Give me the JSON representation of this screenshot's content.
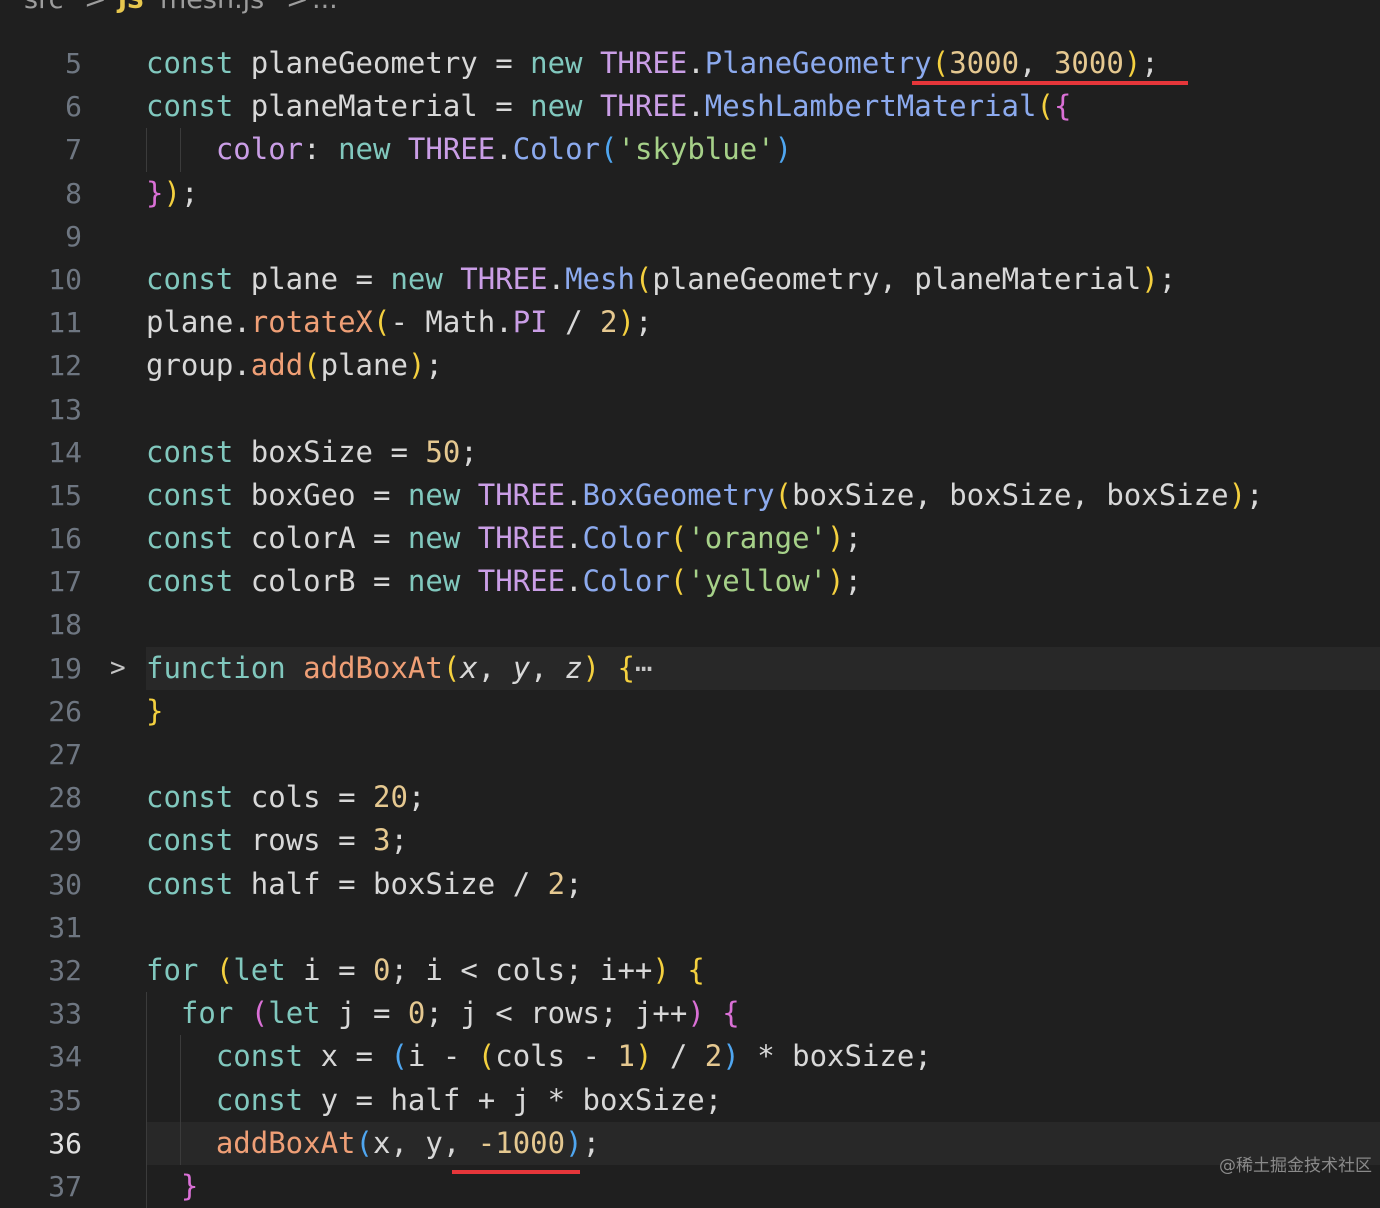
{
  "breadcrumb": {
    "folder": "src",
    "separator": ">",
    "file_icon": "JS",
    "file": "mesh.js",
    "tail": "..."
  },
  "editor": {
    "active_line": "36",
    "colors": {
      "keyword": "#81c8be",
      "class": "#ca9ee6",
      "method": "#8caaee",
      "function": "#ef9f76",
      "number": "#e5c890",
      "string": "#a6d189",
      "annotation_underline": "#e5363a"
    },
    "lines": [
      {
        "n": "5",
        "tokens": [
          [
            "kw",
            "const "
          ],
          [
            "id",
            "planeGeometry "
          ],
          [
            "op",
            "= "
          ],
          [
            "kw",
            "new "
          ],
          [
            "cls",
            "THREE"
          ],
          [
            "op",
            "."
          ],
          [
            "meth",
            "PlaneGeometry"
          ],
          [
            "p1",
            "("
          ],
          [
            "num",
            "3000"
          ],
          [
            "op",
            ", "
          ],
          [
            "num",
            "3000"
          ],
          [
            "p1",
            ")"
          ],
          [
            "op",
            ";"
          ]
        ]
      },
      {
        "n": "6",
        "tokens": [
          [
            "kw",
            "const "
          ],
          [
            "id",
            "planeMaterial "
          ],
          [
            "op",
            "= "
          ],
          [
            "kw",
            "new "
          ],
          [
            "cls",
            "THREE"
          ],
          [
            "op",
            "."
          ],
          [
            "meth",
            "MeshLambertMaterial"
          ],
          [
            "p1",
            "("
          ],
          [
            "p2",
            "{"
          ]
        ]
      },
      {
        "n": "7",
        "tokens": [
          [
            "id",
            "    "
          ],
          [
            "prop",
            "color"
          ],
          [
            "op",
            ": "
          ],
          [
            "kw",
            "new "
          ],
          [
            "cls",
            "THREE"
          ],
          [
            "op",
            "."
          ],
          [
            "meth",
            "Color"
          ],
          [
            "p3",
            "("
          ],
          [
            "str",
            "'skyblue'"
          ],
          [
            "p3",
            ")"
          ]
        ]
      },
      {
        "n": "8",
        "tokens": [
          [
            "p2",
            "}"
          ],
          [
            "p1",
            ")"
          ],
          [
            "op",
            ";"
          ]
        ]
      },
      {
        "n": "9",
        "tokens": []
      },
      {
        "n": "10",
        "tokens": [
          [
            "kw",
            "const "
          ],
          [
            "id",
            "plane "
          ],
          [
            "op",
            "= "
          ],
          [
            "kw",
            "new "
          ],
          [
            "cls",
            "THREE"
          ],
          [
            "op",
            "."
          ],
          [
            "meth",
            "Mesh"
          ],
          [
            "p1",
            "("
          ],
          [
            "id",
            "planeGeometry"
          ],
          [
            "op",
            ", "
          ],
          [
            "id",
            "planeMaterial"
          ],
          [
            "p1",
            ")"
          ],
          [
            "op",
            ";"
          ]
        ]
      },
      {
        "n": "11",
        "tokens": [
          [
            "id",
            "plane"
          ],
          [
            "op",
            "."
          ],
          [
            "fn",
            "rotateX"
          ],
          [
            "p1",
            "("
          ],
          [
            "op",
            "- "
          ],
          [
            "id",
            "Math"
          ],
          [
            "op",
            "."
          ],
          [
            "cls",
            "PI "
          ],
          [
            "op",
            "/ "
          ],
          [
            "num",
            "2"
          ],
          [
            "p1",
            ")"
          ],
          [
            "op",
            ";"
          ]
        ]
      },
      {
        "n": "12",
        "tokens": [
          [
            "id",
            "group"
          ],
          [
            "op",
            "."
          ],
          [
            "fn",
            "add"
          ],
          [
            "p1",
            "("
          ],
          [
            "id",
            "plane"
          ],
          [
            "p1",
            ")"
          ],
          [
            "op",
            ";"
          ]
        ]
      },
      {
        "n": "13",
        "tokens": []
      },
      {
        "n": "14",
        "tokens": [
          [
            "kw",
            "const "
          ],
          [
            "id",
            "boxSize "
          ],
          [
            "op",
            "= "
          ],
          [
            "num",
            "50"
          ],
          [
            "op",
            ";"
          ]
        ]
      },
      {
        "n": "15",
        "tokens": [
          [
            "kw",
            "const "
          ],
          [
            "id",
            "boxGeo "
          ],
          [
            "op",
            "= "
          ],
          [
            "kw",
            "new "
          ],
          [
            "cls",
            "THREE"
          ],
          [
            "op",
            "."
          ],
          [
            "meth",
            "BoxGeometry"
          ],
          [
            "p1",
            "("
          ],
          [
            "id",
            "boxSize"
          ],
          [
            "op",
            ", "
          ],
          [
            "id",
            "boxSize"
          ],
          [
            "op",
            ", "
          ],
          [
            "id",
            "boxSize"
          ],
          [
            "p1",
            ")"
          ],
          [
            "op",
            ";"
          ]
        ]
      },
      {
        "n": "16",
        "tokens": [
          [
            "kw",
            "const "
          ],
          [
            "id",
            "colorA "
          ],
          [
            "op",
            "= "
          ],
          [
            "kw",
            "new "
          ],
          [
            "cls",
            "THREE"
          ],
          [
            "op",
            "."
          ],
          [
            "meth",
            "Color"
          ],
          [
            "p1",
            "("
          ],
          [
            "str",
            "'orange'"
          ],
          [
            "p1",
            ")"
          ],
          [
            "op",
            ";"
          ]
        ]
      },
      {
        "n": "17",
        "tokens": [
          [
            "kw",
            "const "
          ],
          [
            "id",
            "colorB "
          ],
          [
            "op",
            "= "
          ],
          [
            "kw",
            "new "
          ],
          [
            "cls",
            "THREE"
          ],
          [
            "op",
            "."
          ],
          [
            "meth",
            "Color"
          ],
          [
            "p1",
            "("
          ],
          [
            "str",
            "'yellow'"
          ],
          [
            "p1",
            ")"
          ],
          [
            "op",
            ";"
          ]
        ]
      },
      {
        "n": "18",
        "tokens": []
      },
      {
        "n": "19",
        "fold": ">",
        "highlight": true,
        "tokens": [
          [
            "kw",
            "function "
          ],
          [
            "fn",
            "addBoxAt"
          ],
          [
            "p1",
            "("
          ],
          [
            "param",
            "x"
          ],
          [
            "op",
            ", "
          ],
          [
            "param",
            "y"
          ],
          [
            "op",
            ", "
          ],
          [
            "param",
            "z"
          ],
          [
            "p1",
            ")"
          ],
          [
            "op",
            " "
          ],
          [
            "p1",
            "{"
          ],
          [
            "dots",
            "⋯"
          ]
        ]
      },
      {
        "n": "26",
        "tokens": [
          [
            "p1",
            "}"
          ]
        ]
      },
      {
        "n": "27",
        "tokens": []
      },
      {
        "n": "28",
        "tokens": [
          [
            "kw",
            "const "
          ],
          [
            "id",
            "cols "
          ],
          [
            "op",
            "= "
          ],
          [
            "num",
            "20"
          ],
          [
            "op",
            ";"
          ]
        ]
      },
      {
        "n": "29",
        "tokens": [
          [
            "kw",
            "const "
          ],
          [
            "id",
            "rows "
          ],
          [
            "op",
            "= "
          ],
          [
            "num",
            "3"
          ],
          [
            "op",
            ";"
          ]
        ]
      },
      {
        "n": "30",
        "tokens": [
          [
            "kw",
            "const "
          ],
          [
            "id",
            "half "
          ],
          [
            "op",
            "= "
          ],
          [
            "id",
            "boxSize "
          ],
          [
            "op",
            "/ "
          ],
          [
            "num",
            "2"
          ],
          [
            "op",
            ";"
          ]
        ]
      },
      {
        "n": "31",
        "tokens": []
      },
      {
        "n": "32",
        "tokens": [
          [
            "kw",
            "for "
          ],
          [
            "p1",
            "("
          ],
          [
            "kw",
            "let "
          ],
          [
            "id",
            "i "
          ],
          [
            "op",
            "= "
          ],
          [
            "num",
            "0"
          ],
          [
            "op",
            "; "
          ],
          [
            "id",
            "i "
          ],
          [
            "op",
            "< "
          ],
          [
            "id",
            "cols"
          ],
          [
            "op",
            "; "
          ],
          [
            "id",
            "i"
          ],
          [
            "op",
            "++"
          ],
          [
            "p1",
            ")"
          ],
          [
            "op",
            " "
          ],
          [
            "p1",
            "{"
          ]
        ]
      },
      {
        "n": "33",
        "tokens": [
          [
            "id",
            "  "
          ],
          [
            "kw",
            "for "
          ],
          [
            "p2",
            "("
          ],
          [
            "kw",
            "let "
          ],
          [
            "id",
            "j "
          ],
          [
            "op",
            "= "
          ],
          [
            "num",
            "0"
          ],
          [
            "op",
            "; "
          ],
          [
            "id",
            "j "
          ],
          [
            "op",
            "< "
          ],
          [
            "id",
            "rows"
          ],
          [
            "op",
            "; "
          ],
          [
            "id",
            "j"
          ],
          [
            "op",
            "++"
          ],
          [
            "p2",
            ")"
          ],
          [
            "op",
            " "
          ],
          [
            "p2",
            "{"
          ]
        ]
      },
      {
        "n": "34",
        "tokens": [
          [
            "id",
            "    "
          ],
          [
            "kw",
            "const "
          ],
          [
            "id",
            "x "
          ],
          [
            "op",
            "= "
          ],
          [
            "p3",
            "("
          ],
          [
            "id",
            "i "
          ],
          [
            "op",
            "- "
          ],
          [
            "p1",
            "("
          ],
          [
            "id",
            "cols "
          ],
          [
            "op",
            "- "
          ],
          [
            "num",
            "1"
          ],
          [
            "p1",
            ")"
          ],
          [
            "op",
            " / "
          ],
          [
            "num",
            "2"
          ],
          [
            "p3",
            ")"
          ],
          [
            "op",
            " * "
          ],
          [
            "id",
            "boxSize"
          ],
          [
            "op",
            ";"
          ]
        ]
      },
      {
        "n": "35",
        "tokens": [
          [
            "id",
            "    "
          ],
          [
            "kw",
            "const "
          ],
          [
            "id",
            "y "
          ],
          [
            "op",
            "= "
          ],
          [
            "id",
            "half "
          ],
          [
            "op",
            "+ "
          ],
          [
            "id",
            "j "
          ],
          [
            "op",
            "* "
          ],
          [
            "id",
            "boxSize"
          ],
          [
            "op",
            ";"
          ]
        ]
      },
      {
        "n": "36",
        "active": true,
        "highlight": true,
        "tokens": [
          [
            "id",
            "    "
          ],
          [
            "fn",
            "addBoxAt"
          ],
          [
            "p3",
            "("
          ],
          [
            "id",
            "x"
          ],
          [
            "op",
            ", "
          ],
          [
            "id",
            "y"
          ],
          [
            "op",
            ", "
          ],
          [
            "num",
            "-1000"
          ],
          [
            "p3",
            ")"
          ],
          [
            "op",
            ";"
          ]
        ]
      },
      {
        "n": "37",
        "tokens": [
          [
            "id",
            "  "
          ],
          [
            "p2",
            "}"
          ]
        ]
      }
    ]
  },
  "watermark": "@稀土掘金技术社区"
}
